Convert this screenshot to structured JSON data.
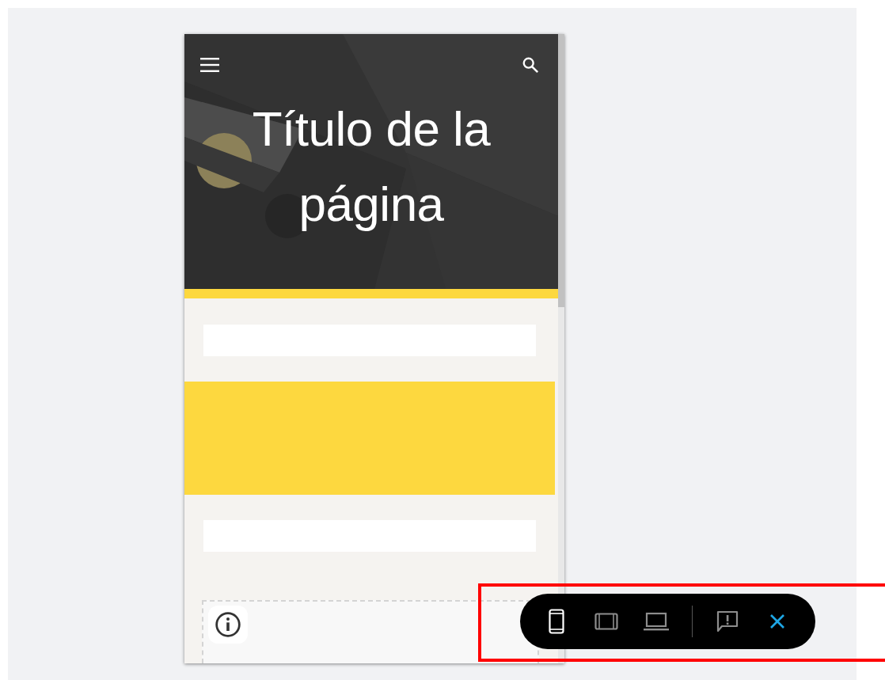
{
  "page": {
    "title": "Título de la página"
  },
  "toolbar": {
    "devices": [
      {
        "kind": "phone",
        "selected": true
      },
      {
        "kind": "tablet",
        "selected": false
      },
      {
        "kind": "laptop",
        "selected": false
      }
    ]
  }
}
